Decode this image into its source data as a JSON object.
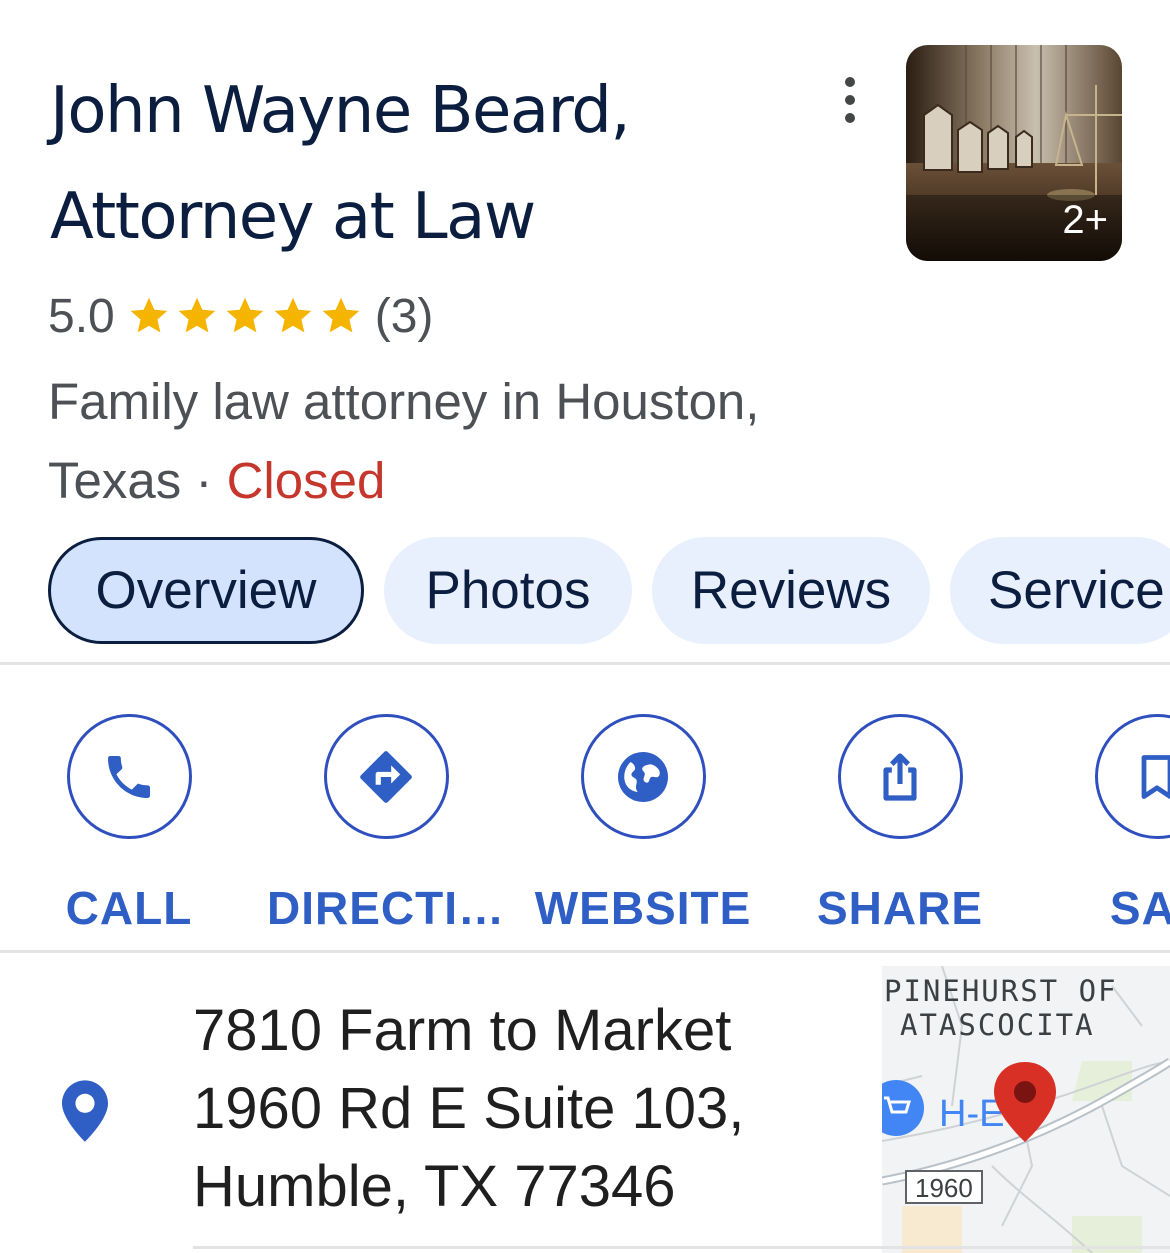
{
  "place": {
    "title_line1": "John Wayne Beard,",
    "title_line2": "Attorney at Law",
    "rating": "5.0",
    "stars": 5,
    "review_count": "(3)",
    "category_line1": "Family law attorney in Houston,",
    "category_line2_prefix": "Texas · ",
    "status": "Closed",
    "photo_count": "2+"
  },
  "tabs": [
    {
      "label": "Overview",
      "active": true
    },
    {
      "label": "Photos",
      "active": false
    },
    {
      "label": "Reviews",
      "active": false
    },
    {
      "label": "Service",
      "active": false
    }
  ],
  "actions": {
    "call": "CALL",
    "directions": "DIRECTI…",
    "website": "WEBSITE",
    "share": "SHARE",
    "save": "SAV"
  },
  "address": {
    "line1": "7810 Farm to Market",
    "line2": "1960 Rd E Suite 103,",
    "line3": "Humble, TX 77346"
  },
  "map": {
    "area_line1": "PINEHURST OF",
    "area_line2": "ATASCOCITA",
    "poi_label": "H-E",
    "road_shield": "1960"
  },
  "colors": {
    "accent": "#2f5ec4",
    "closed": "#c5372c",
    "star": "#f4b400",
    "chip_bg": "#e8effd",
    "pin_red": "#d93025"
  },
  "icons": {
    "call": "phone-icon",
    "directions": "directions-icon",
    "website": "globe-icon",
    "share": "share-icon",
    "save": "bookmark-icon",
    "address": "location-pin-icon"
  }
}
